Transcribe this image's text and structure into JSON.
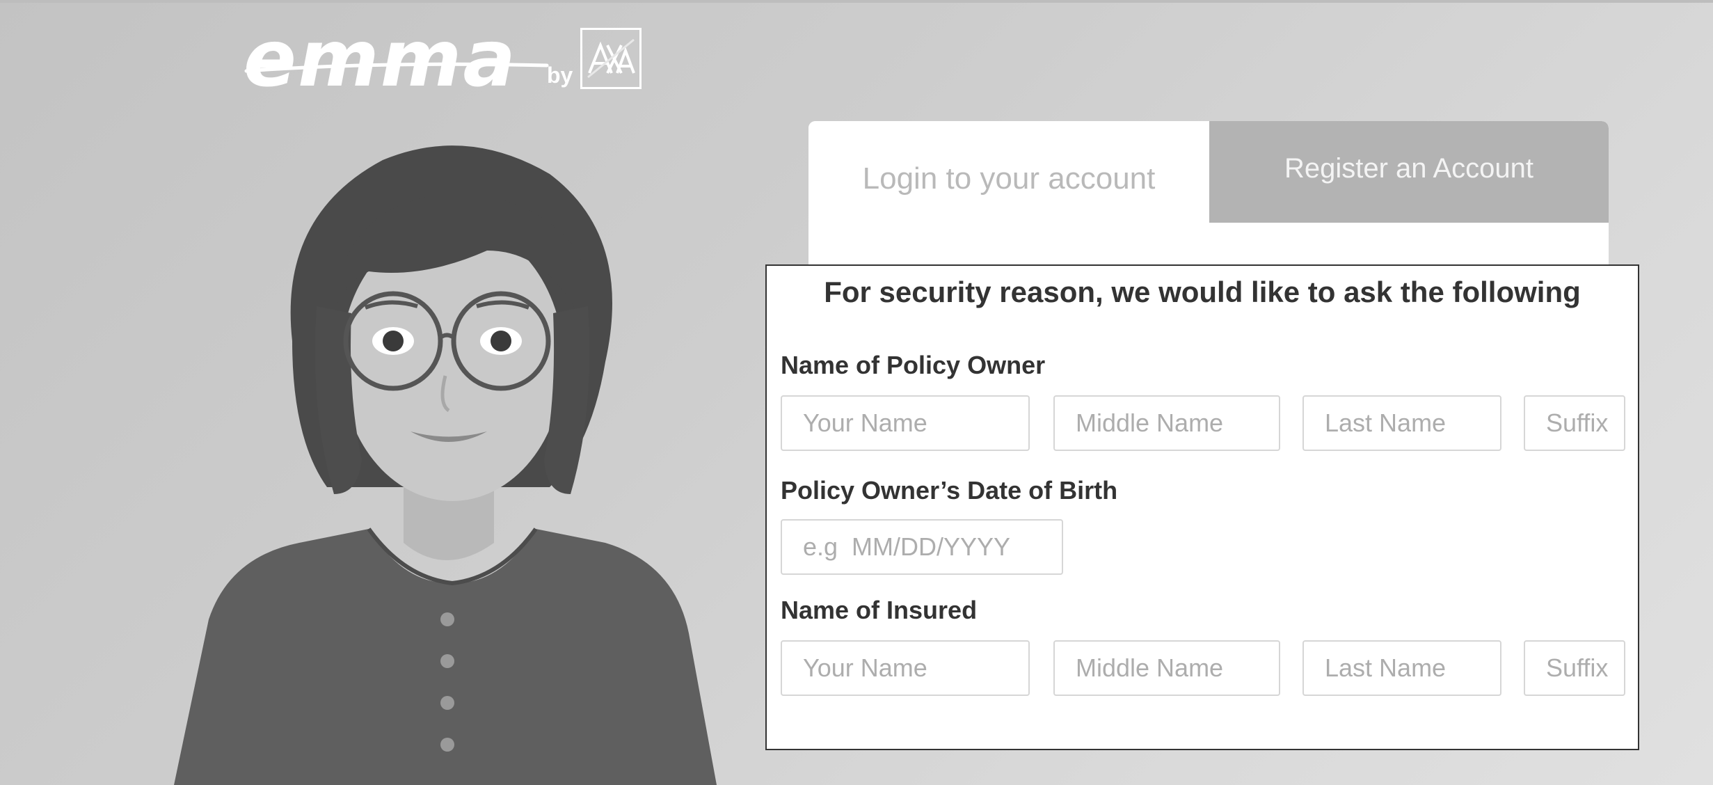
{
  "brand": {
    "logo_word": "emma",
    "by": "by",
    "partner": "AXA"
  },
  "auth": {
    "login_tab": "Login to your account",
    "register_tab": "Register an Account"
  },
  "security": {
    "title": "For security reason, we would like to ask the following",
    "policy_owner": {
      "label": "Name of Policy Owner",
      "first_placeholder": "Your Name",
      "middle_placeholder": "Middle Name",
      "last_placeholder": "Last Name",
      "suffix_placeholder": "Suffix"
    },
    "dob": {
      "label": "Policy Owner’s Date of Birth",
      "placeholder": "e.g  MM/DD/YYYY"
    },
    "insured": {
      "label": "Name of Insured",
      "first_placeholder": "Your Name",
      "middle_placeholder": "Middle Name",
      "last_placeholder": "Last Name",
      "suffix_placeholder": "Suffix"
    }
  },
  "colors": {
    "background": "#cccccc",
    "text_dark": "#333333",
    "placeholder": "#adadad",
    "register_tab_bg": "#b3b3b3"
  }
}
